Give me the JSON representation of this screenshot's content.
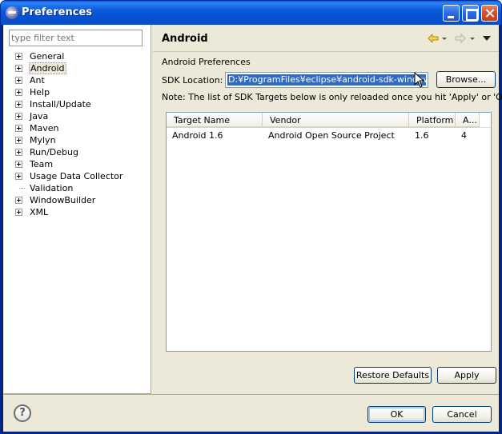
{
  "window": {
    "title": "Preferences",
    "title_icon": "eclipse-icon",
    "controls": [
      "minimize-icon",
      "maximize-icon",
      "close-icon"
    ]
  },
  "sidebar": {
    "filter_placeholder": "type filter text",
    "items": [
      {
        "label": "General",
        "expandable": true,
        "selected": false
      },
      {
        "label": "Android",
        "expandable": true,
        "selected": true
      },
      {
        "label": "Ant",
        "expandable": true,
        "selected": false
      },
      {
        "label": "Help",
        "expandable": true,
        "selected": false
      },
      {
        "label": "Install/Update",
        "expandable": true,
        "selected": false
      },
      {
        "label": "Java",
        "expandable": true,
        "selected": false
      },
      {
        "label": "Maven",
        "expandable": true,
        "selected": false
      },
      {
        "label": "Mylyn",
        "expandable": true,
        "selected": false
      },
      {
        "label": "Run/Debug",
        "expandable": true,
        "selected": false
      },
      {
        "label": "Team",
        "expandable": true,
        "selected": false
      },
      {
        "label": "Usage Data Collector",
        "expandable": true,
        "selected": false
      },
      {
        "label": "Validation",
        "expandable": false,
        "selected": false
      },
      {
        "label": "WindowBuilder",
        "expandable": true,
        "selected": false
      },
      {
        "label": "XML",
        "expandable": true,
        "selected": false
      }
    ]
  },
  "page": {
    "title": "Android",
    "nav_back_icon": "back-arrow-icon",
    "nav_forward_icon": "forward-arrow-icon",
    "view_menu_icon": "view-menu-icon",
    "section_label": "Android Preferences",
    "sdk_location_label": "SDK Location:",
    "sdk_location_value": "D:¥ProgramFiles¥eclipse¥android-sdk-windows",
    "browse_label": "Browse...",
    "note": "Note: The list of SDK Targets below is only reloaded once you hit 'Apply' or 'OK'.",
    "table": {
      "columns": [
        "Target Name",
        "Vendor",
        "Platform",
        "A..."
      ],
      "rows": [
        [
          "Android 1.6",
          "Android Open Source Project",
          "1.6",
          "4"
        ]
      ]
    },
    "restore_defaults_label": "Restore Defaults",
    "apply_label": "Apply"
  },
  "footer": {
    "help_icon": "help-icon",
    "help_glyph": "?",
    "ok_label": "OK",
    "cancel_label": "Cancel"
  },
  "colors": {
    "titlebar": "#0a5fe8",
    "dialog_bg": "#ece9d8",
    "selection": "#316ac5",
    "field_border": "#7f9db9"
  }
}
